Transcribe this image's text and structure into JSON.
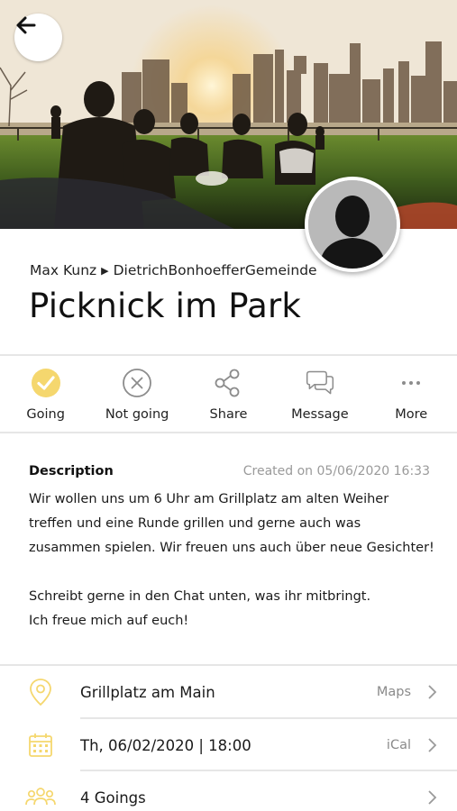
{
  "header": {
    "back_icon": "arrow-left-icon"
  },
  "event": {
    "author": "Max Kunz",
    "group": "DietrichBonhoefferGemeinde",
    "title": "Picknick im Park"
  },
  "actions": [
    {
      "label": "Going",
      "icon": "check-circle-icon",
      "active": true
    },
    {
      "label": "Not going",
      "icon": "x-circle-icon",
      "active": false
    },
    {
      "label": "Share",
      "icon": "share-icon",
      "active": false
    },
    {
      "label": "Message",
      "icon": "chat-bubbles-icon",
      "active": false
    },
    {
      "label": "More",
      "icon": "more-dots-icon",
      "active": false
    }
  ],
  "description": {
    "heading": "Description",
    "created": "Created on 05/06/2020 16:33",
    "lines": [
      "Wir wollen uns um 6 Uhr am Grillplatz am alten Weiher",
      "treffen und eine Runde grillen und gerne auch was",
      "zusammen spielen. Wir freuen uns auch über neue Gesichter!",
      "",
      "Schreibt gerne in den Chat unten, was ihr mitbringt.",
      "Ich freue mich auf euch!"
    ]
  },
  "info": {
    "location": {
      "text": "Grillplatz am Main",
      "link": "Maps",
      "icon": "location-pin-icon"
    },
    "date": {
      "text": "Th, 06/02/2020 | 18:00",
      "link": "iCal",
      "icon": "calendar-icon"
    },
    "goings": {
      "text": "4 Goings",
      "icon": "people-icon"
    }
  },
  "colors": {
    "accent": "#f5d76e",
    "icon_gray": "#8c8c8c",
    "divider": "#e6e6e6"
  }
}
